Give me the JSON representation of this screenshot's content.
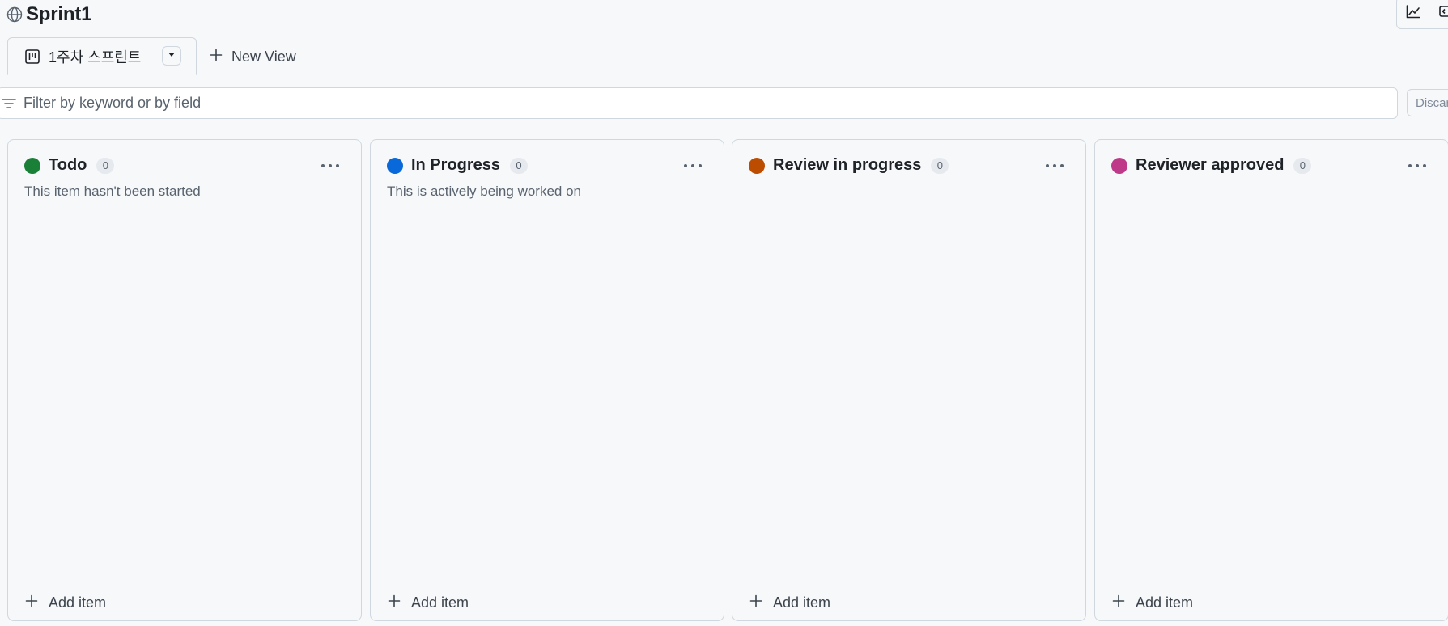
{
  "project": {
    "title": "Sprint1"
  },
  "tabs": {
    "active_label": "1주차 스프린트",
    "new_view_label": "New View"
  },
  "filter": {
    "placeholder": "Filter by keyword or by field",
    "discard_label": "Discard"
  },
  "columns": [
    {
      "title": "Todo",
      "count": "0",
      "description": "This item hasn't been started",
      "color": "#1a7f37",
      "add_label": "Add item"
    },
    {
      "title": "In Progress",
      "count": "0",
      "description": "This is actively being worked on",
      "color": "#0969da",
      "add_label": "Add item"
    },
    {
      "title": "Review in progress",
      "count": "0",
      "description": "",
      "color": "#bc4c00",
      "add_label": "Add item"
    },
    {
      "title": "Reviewer approved",
      "count": "0",
      "description": "",
      "color": "#bf3989",
      "add_label": "Add item"
    }
  ],
  "icons": {
    "globe": "globe-icon",
    "board": "project-board-icon",
    "triangle_down": "triangle-down-icon",
    "plus": "plus-icon",
    "filter": "filter-icon",
    "kebab": "kebab-horizontal-icon",
    "graph": "graph-icon",
    "sidebar": "sidebar-expand-icon"
  }
}
